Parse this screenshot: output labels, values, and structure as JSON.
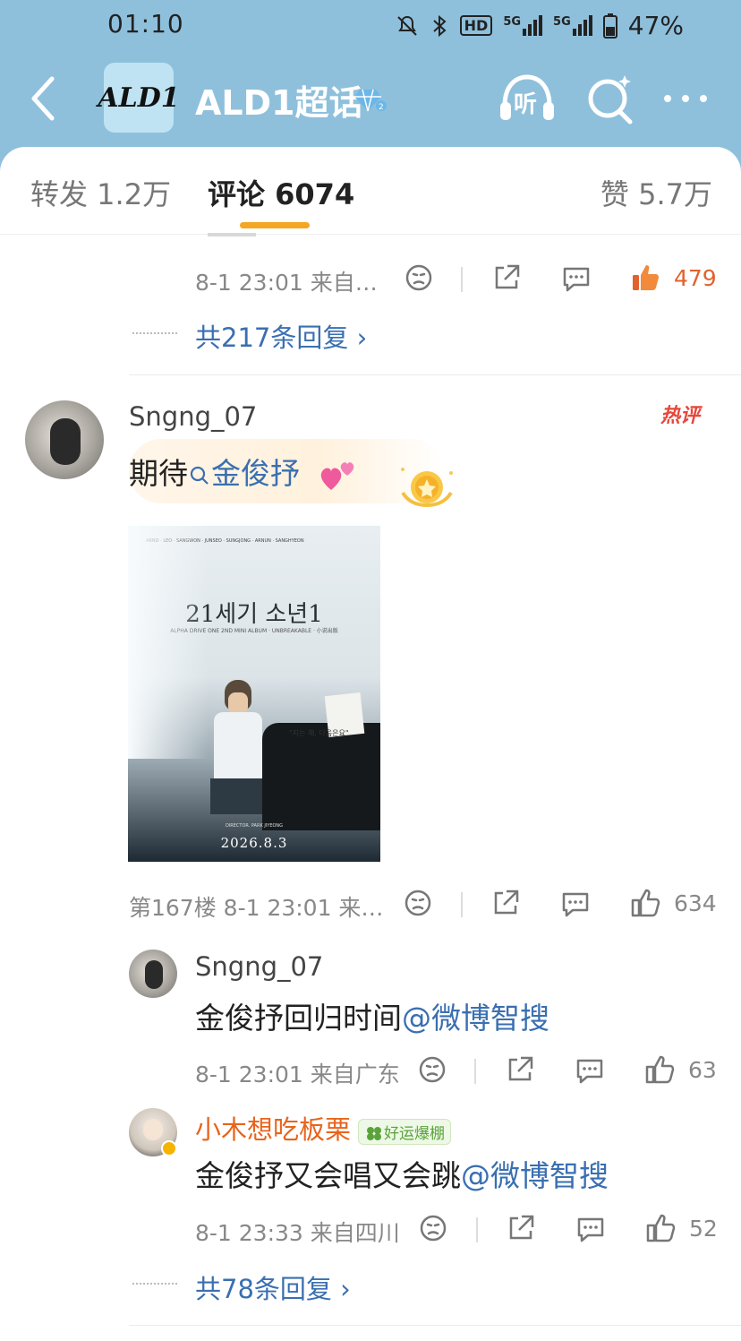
{
  "status": {
    "time": "01:10",
    "hd": "HD",
    "net1": "5G",
    "net2": "5G",
    "battery": "47%"
  },
  "header": {
    "logo_text": "ALD1",
    "title": "ALD1超话",
    "listen_label": "听"
  },
  "tabs": {
    "repost": "转发 1.2万",
    "comment": "评论 6074",
    "like": "赞 5.7万"
  },
  "top_item": {
    "meta": "8-1 23:01  来自…",
    "likes": "479",
    "more_replies": "共217条回复 ›"
  },
  "comment": {
    "user": "Sngng_07",
    "hot_tag": "热评",
    "text_prefix": "期待",
    "text_link": "金俊抒",
    "meta": "第167楼  8-1 23:01  来…",
    "likes": "634",
    "poster": {
      "title": "21세기 소년1",
      "subtitle": "ALPHA DRIVE ONE 2ND MINI ALBUM · UNBREAKABLE · 小说出版",
      "names": "ARNO · LEO · SANGWON · JUNSEO · SUNGJONG · ARNUN · SANGHYEON",
      "quote": "\"지는 해, 다음은요\"",
      "director": "DIRECTOR. PARK JIYEONG",
      "date": "2026.8.3"
    }
  },
  "replies": [
    {
      "user": "Sngng_07",
      "text": "金俊抒回归时间",
      "link": "@微博智搜",
      "meta": "8-1 23:01  来自广东",
      "likes": "63"
    },
    {
      "user": "小木想吃板栗",
      "badge": "好运爆棚",
      "text": "金俊抒又会唱又会跳",
      "link": "@微博智搜",
      "meta": "8-1 23:33  来自四川",
      "likes": "52"
    }
  ],
  "more_replies_2": "共78条回复 ›",
  "colors": {
    "header_bg": "#8ec0dc",
    "link": "#3a6fb0",
    "accent": "#f5a623",
    "hot_like": "#e0622d"
  }
}
